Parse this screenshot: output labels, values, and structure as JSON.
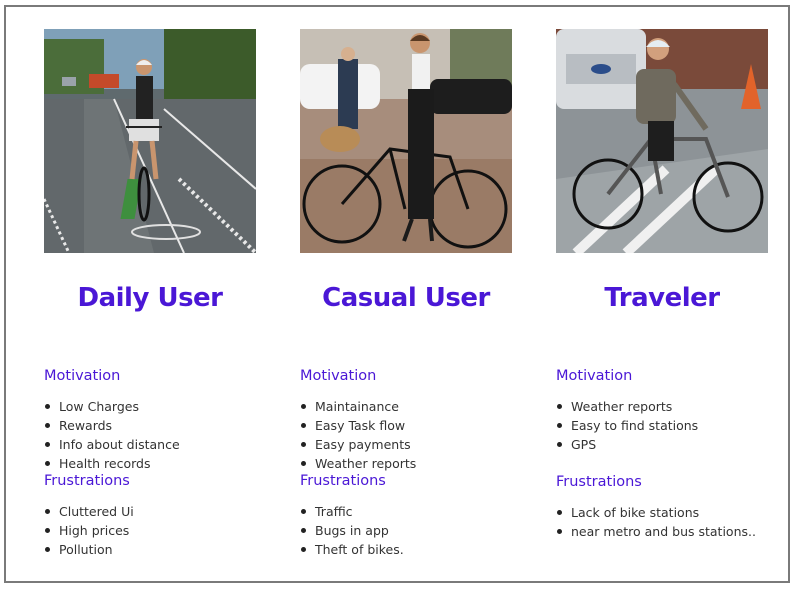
{
  "personas": [
    {
      "title": "Daily User",
      "motivation_label": "Motivation",
      "motivations": [
        "Low Charges",
        "Rewards",
        "Info about distance",
        "Health records"
      ],
      "frustrations_label": "Frustrations",
      "frustrations": [
        "Cluttered Ui",
        "High prices",
        "Pollution"
      ]
    },
    {
      "title": "Casual User",
      "motivation_label": "Motivation",
      "motivations": [
        "Maintainance",
        "Easy Task flow",
        "Easy payments",
        "Weather reports"
      ],
      "frustrations_label": "Frustrations",
      "frustrations": [
        "Traffic",
        "Bugs in app",
        "Theft of bikes."
      ]
    },
    {
      "title": "Traveler",
      "motivation_label": "Motivation",
      "motivations": [
        "Weather reports",
        "Easy to find stations",
        "GPS"
      ],
      "frustrations_label": "Frustrations",
      "frustrations": [
        "Lack of bike stations",
        "near metro and bus stations.."
      ]
    }
  ],
  "colors": {
    "accent": "#4a17d6",
    "body_text": "#333333",
    "border": "#7a7a7a"
  }
}
